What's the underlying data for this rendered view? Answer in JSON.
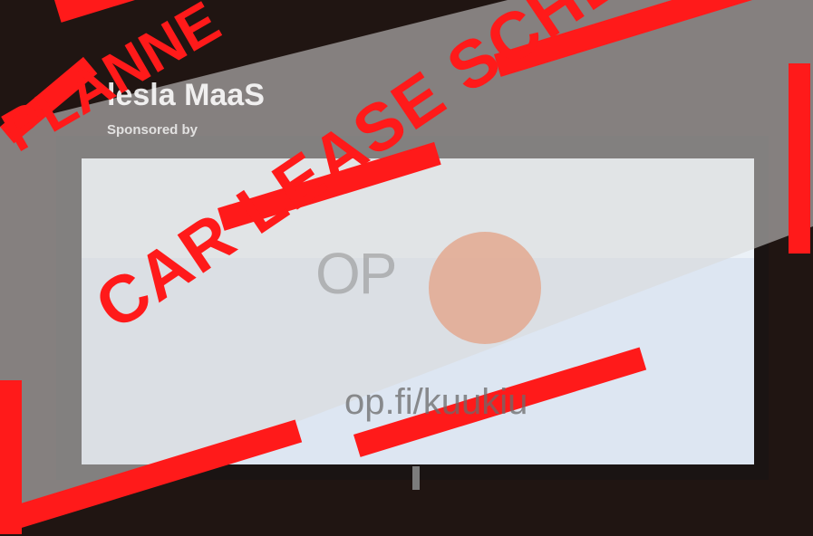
{
  "slide": {
    "title": "lesla MaaS",
    "subtitle": "Sponsored by",
    "logo_text": "OP",
    "url": "op.fi/kuukiu"
  },
  "stamp": {
    "main_text": "CAR LEASE SCHEME",
    "corner_text": "PLANNE",
    "color": "#ff1a1a"
  },
  "colors": {
    "screen_bg": "#dde6f2",
    "bezel": "#1a1413",
    "wall": "#2b1d18",
    "overlay": "#d9d9d9",
    "logo_orange": "#f0703a"
  }
}
